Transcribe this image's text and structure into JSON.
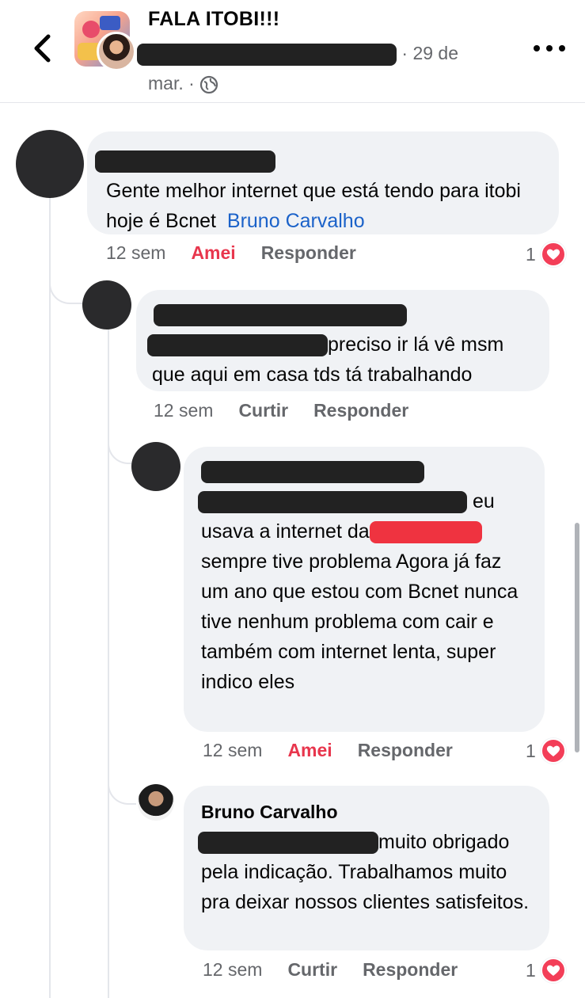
{
  "header": {
    "group_title": "FALA ITOBI!!!",
    "date_text": "· 29 de mar. ·",
    "icons": {
      "back": "chevron-left-icon",
      "privacy": "globe-icon",
      "more": "more-horizontal-icon"
    }
  },
  "comments": [
    {
      "text": "Gente melhor internet que está tendo para itobi hoje é Bcnet",
      "mention": "Bruno Carvalho",
      "time": "12 sem",
      "like_label": "Amei",
      "reply_label": "Responder",
      "reaction_count": "1"
    },
    {
      "text": "preciso ir lá vê msm que aqui em casa tds tá trabalhando",
      "time": "12 sem",
      "like_label": "Curtir",
      "reply_label": "Responder"
    },
    {
      "text_line1": "eu",
      "text_line2": "usava a internet da",
      "text_rest": "sempre tive problema Agora já faz um ano que estou com Bcnet nunca tive nenhum problema com cair e também com internet lenta, super indico eles",
      "time": "12 sem",
      "like_label": "Amei",
      "reply_label": "Responder",
      "reaction_count": "1"
    },
    {
      "author": "Bruno Carvalho",
      "text_line1": "muito obrigado",
      "text_rest": "pela indicação. Trabalhamos muito pra deixar nossos clientes satisfeitos.",
      "time": "12 sem",
      "like_label": "Curtir",
      "reply_label": "Responder",
      "reaction_count": "1"
    }
  ],
  "colors": {
    "bubble_bg": "#f0f2f5",
    "mention": "#1b62c9",
    "love_red": "#e8364d",
    "secondary_text": "#65676b"
  }
}
